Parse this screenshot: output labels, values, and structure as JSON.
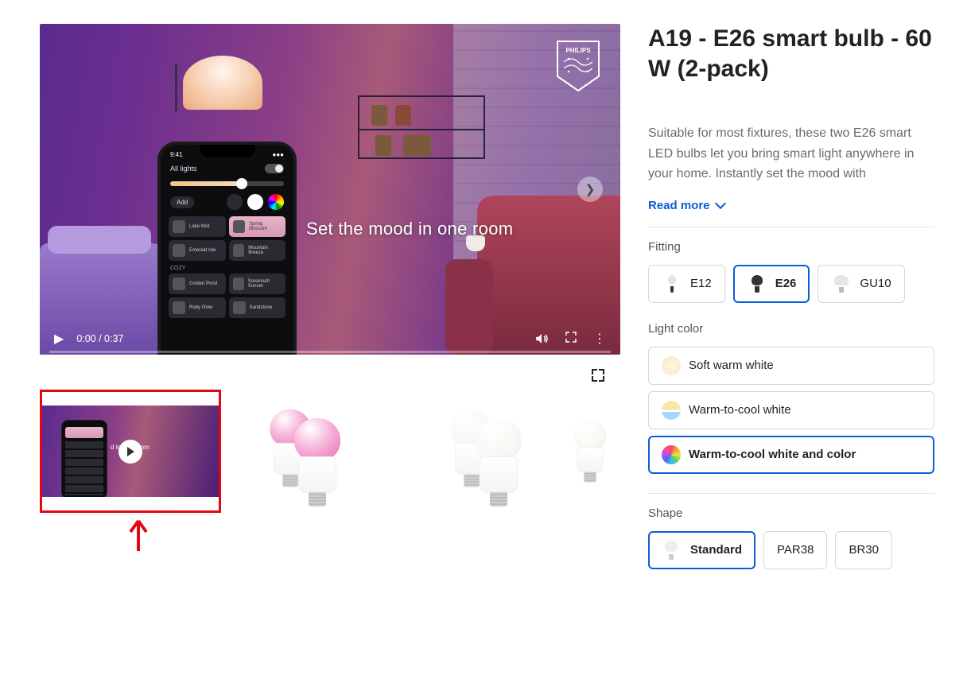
{
  "product": {
    "title": "A19 - E26 smart bulb - 60 W (2-pack)",
    "description": "Suitable for most fixtures, these two E26 smart LED bulbs let you bring smart light anywhere in your home. Instantly set the mood with",
    "read_more": "Read more"
  },
  "video": {
    "brand": "PHILIPS",
    "tagline": "Set the mood in one room",
    "thumb_tagline": "d in one room",
    "time": "0:00 / 0:37",
    "phone": {
      "time": "9:41",
      "header": "All lights",
      "add": "Add",
      "section": "COZY",
      "tiles": [
        "Lake Mist",
        "Spring Blossom",
        "Emerald Isle",
        "Mountain Breeze",
        "Golden Pond",
        "Savannah Sunset",
        "Ruby Glow",
        "Sandstone"
      ]
    }
  },
  "thumbnails": [
    {
      "type": "video",
      "selected": true
    },
    {
      "type": "pink"
    },
    {
      "type": "white"
    },
    {
      "type": "spec"
    }
  ],
  "options": {
    "fitting": {
      "label": "Fitting",
      "items": [
        {
          "id": "e12",
          "label": "E12",
          "selected": false
        },
        {
          "id": "e26",
          "label": "E26",
          "selected": true
        },
        {
          "id": "gu10",
          "label": "GU10",
          "selected": false
        }
      ]
    },
    "light_color": {
      "label": "Light color",
      "items": [
        {
          "id": "soft",
          "label": "Soft warm white",
          "selected": false
        },
        {
          "id": "wc",
          "label": "Warm-to-cool white",
          "selected": false
        },
        {
          "id": "rgb",
          "label": "Warm-to-cool white and color",
          "selected": true
        }
      ]
    },
    "shape": {
      "label": "Shape",
      "items": [
        {
          "id": "standard",
          "label": "Standard",
          "selected": true
        },
        {
          "id": "par38",
          "label": "PAR38",
          "selected": false
        },
        {
          "id": "br30",
          "label": "BR30",
          "selected": false
        }
      ]
    }
  }
}
